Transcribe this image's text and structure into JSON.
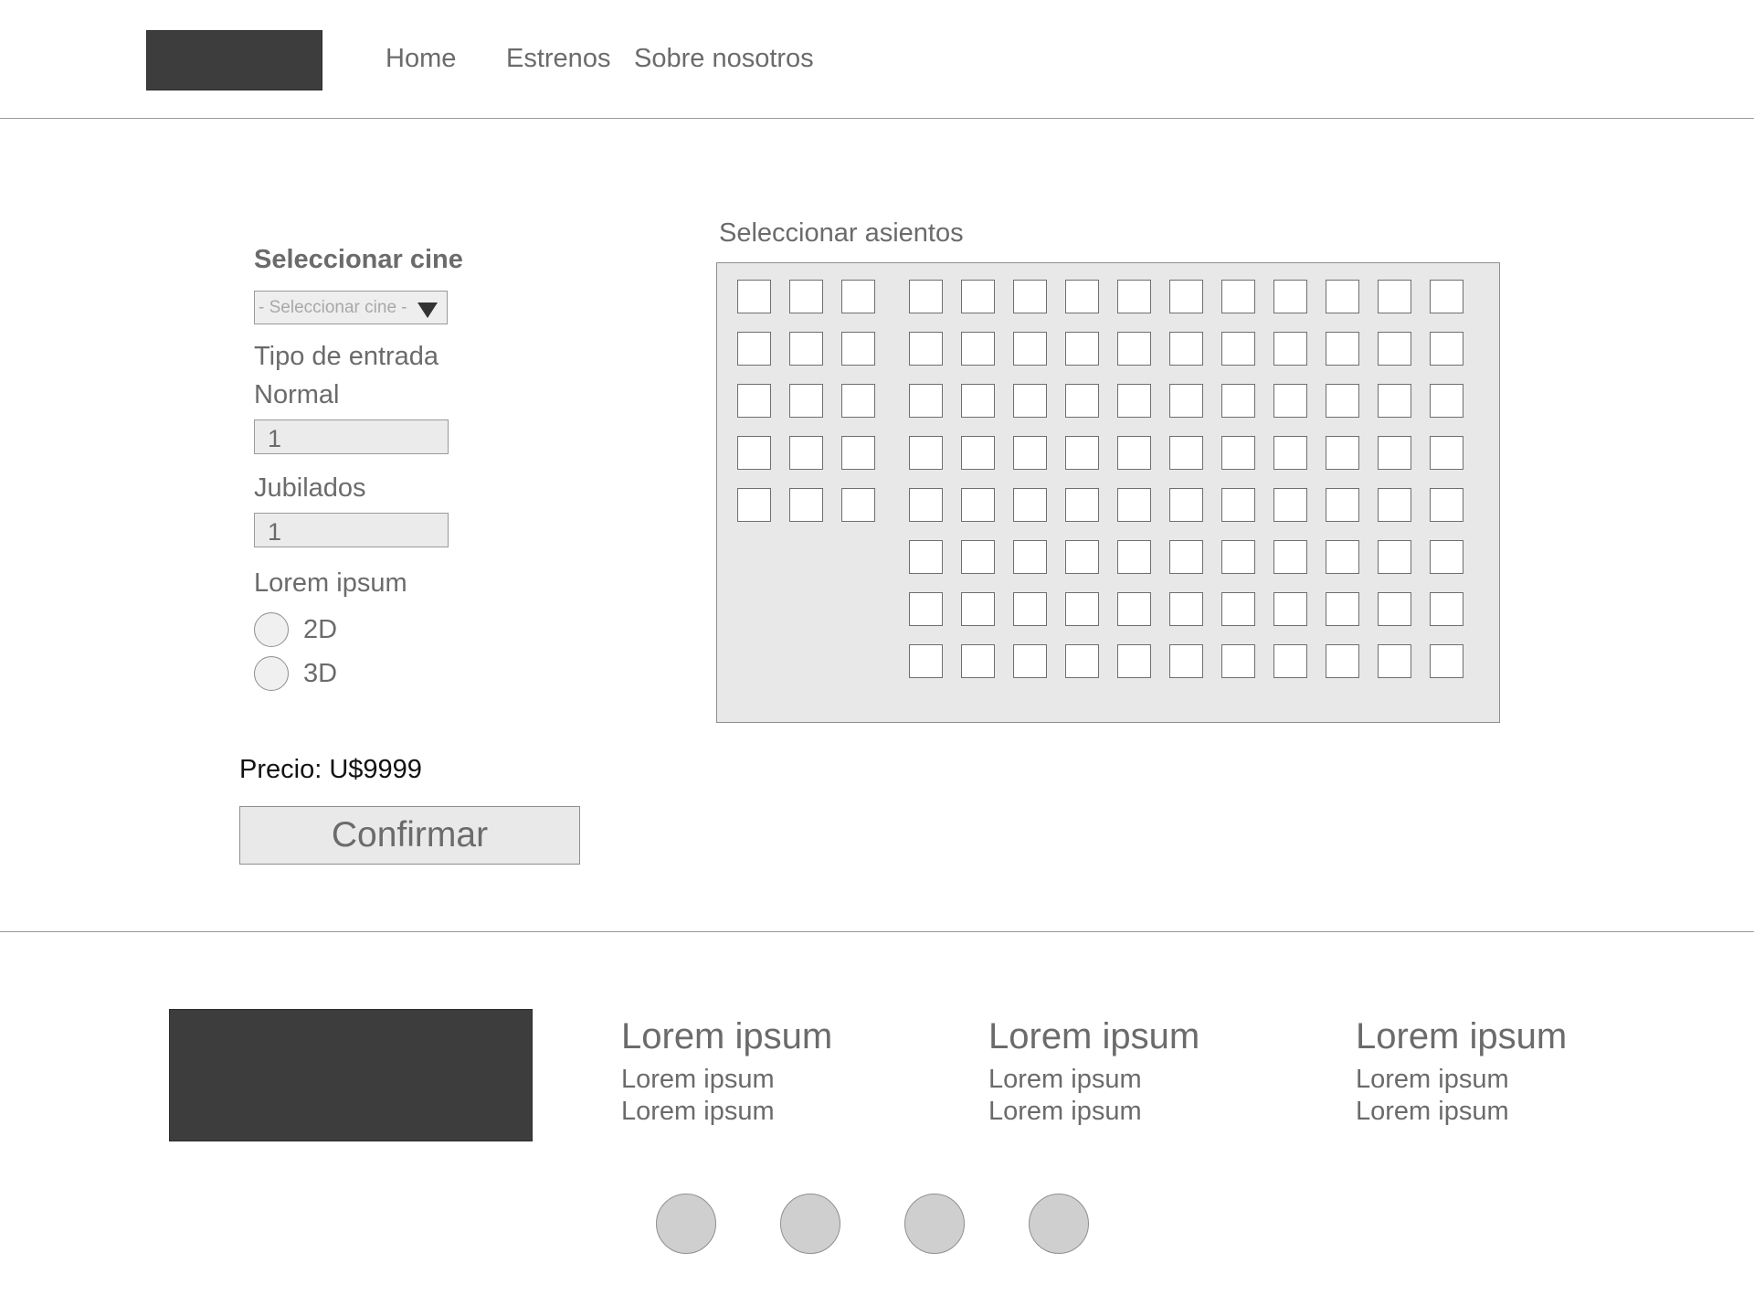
{
  "header": {
    "nav": [
      {
        "label": "Home"
      },
      {
        "label": "Estrenos"
      },
      {
        "label": "Sobre nosotros"
      }
    ]
  },
  "form": {
    "cinema_label": "Seleccionar cine",
    "cinema_select": {
      "selected": "- Seleccionar cine -"
    },
    "ticket_type_label": "Tipo de entrada",
    "normal_label": "Normal",
    "normal_value": "1",
    "jubilados_label": "Jubilados",
    "jubilados_value": "1",
    "format_label": "Lorem ipsum",
    "format_options": [
      {
        "label": "2D",
        "checked": false
      },
      {
        "label": "3D",
        "checked": false
      }
    ],
    "price_text": "Precio: U$9999",
    "confirm_label": "Confirmar"
  },
  "seats": {
    "title": "Seleccionar asientos",
    "left_block": {
      "rows": 5,
      "cols": 3
    },
    "right_block": {
      "rows": 8,
      "cols": 11
    }
  },
  "footer": {
    "columns": [
      {
        "heading": "Lorem ipsum",
        "links": [
          "Lorem ipsum",
          "Lorem ipsum"
        ]
      },
      {
        "heading": "Lorem ipsum",
        "links": [
          "Lorem ipsum",
          "Lorem ipsum"
        ]
      },
      {
        "heading": "Lorem ipsum",
        "links": [
          "Lorem ipsum",
          "Lorem ipsum"
        ]
      }
    ],
    "social_count": 4
  }
}
